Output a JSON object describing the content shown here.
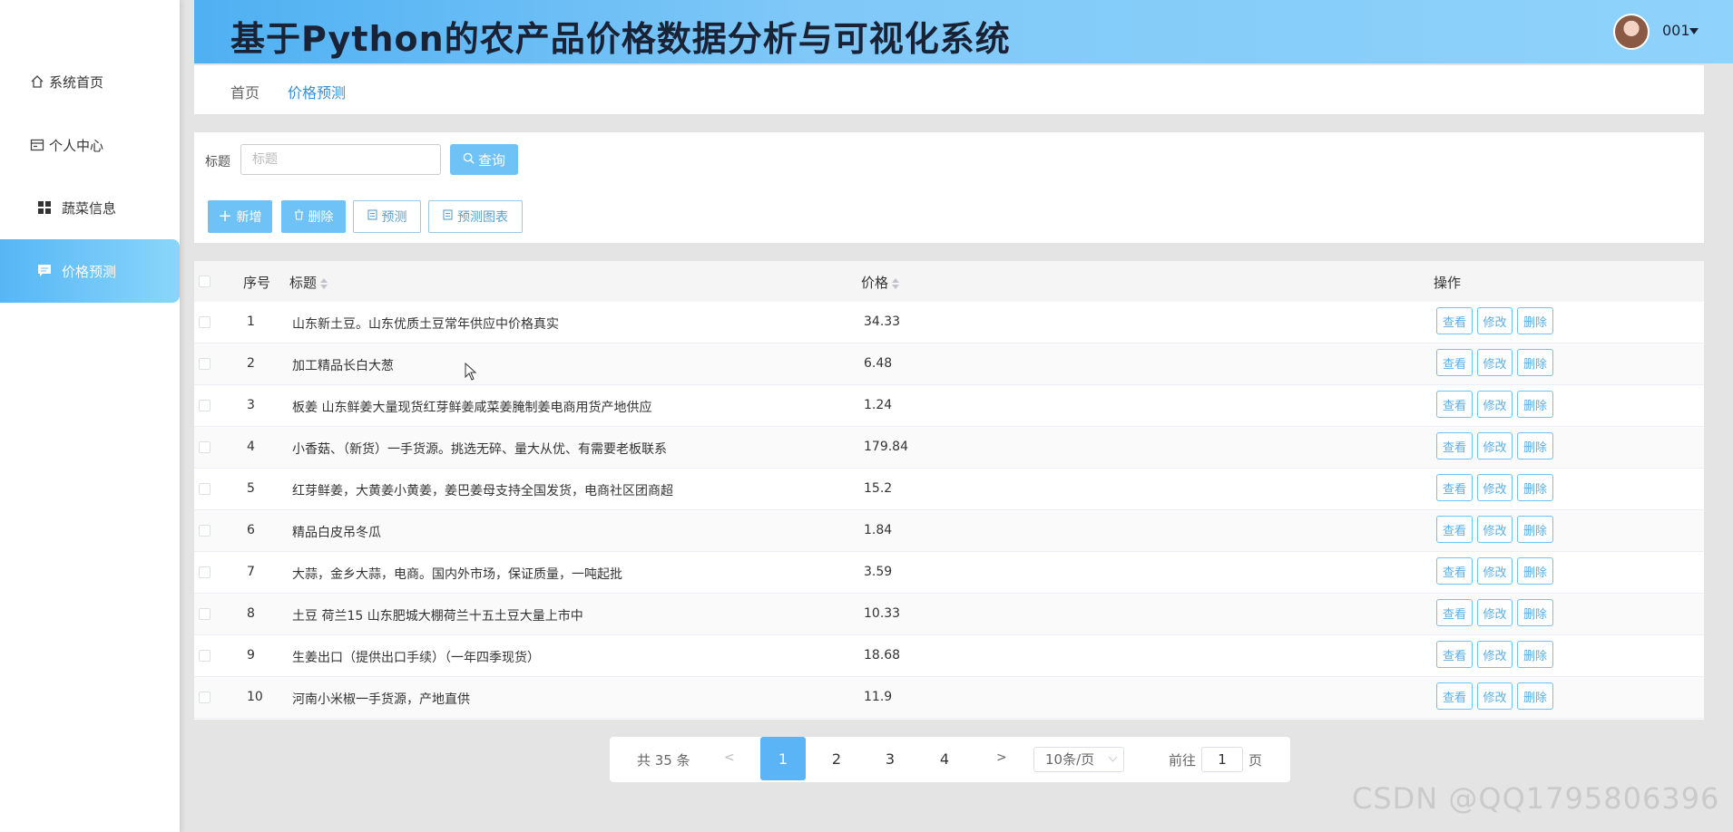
{
  "app": {
    "title": "基于Python的农产品价格数据分析与可视化系统",
    "user": "001"
  },
  "sidebar": {
    "items": [
      {
        "label": "系统首页",
        "icon": "home-icon",
        "active": false
      },
      {
        "label": "个人中心",
        "icon": "card-icon",
        "active": false
      },
      {
        "label": "蔬菜信息",
        "icon": "grid-icon",
        "active": false
      },
      {
        "label": "价格预测",
        "icon": "chat-icon",
        "active": true
      }
    ]
  },
  "breadcrumb": {
    "home": "首页",
    "current": "价格预测"
  },
  "search": {
    "label": "标题",
    "placeholder": "标题",
    "query_button": "查询"
  },
  "actions": {
    "add": "新增",
    "delete": "删除",
    "predict": "预测",
    "predict_chart": "预测图表"
  },
  "table": {
    "headers": {
      "index": "序号",
      "title": "标题",
      "price": "价格",
      "ops": "操作"
    },
    "op_labels": {
      "view": "查看",
      "edit": "修改",
      "delete": "删除"
    },
    "rows": [
      {
        "index": "1",
        "title": "山东新土豆。山东优质土豆常年供应中价格真实",
        "price": "34.33"
      },
      {
        "index": "2",
        "title": "加工精品长白大葱",
        "price": "6.48"
      },
      {
        "index": "3",
        "title": "板姜 山东鲜姜大量现货红芽鲜姜咸菜姜腌制姜电商用货产地供应",
        "price": "1.24"
      },
      {
        "index": "4",
        "title": "小香菇、（新货）一手货源。挑选无碎、量大从优、有需要老板联系",
        "price": "179.84"
      },
      {
        "index": "5",
        "title": "红芽鲜姜，大黄姜小黄姜，姜巴姜母支持全国发货，电商社区团商超",
        "price": "15.2"
      },
      {
        "index": "6",
        "title": "精品白皮吊冬瓜",
        "price": "1.84"
      },
      {
        "index": "7",
        "title": "大蒜，金乡大蒜，电商。国内外市场，保证质量，一吨起批",
        "price": "3.59"
      },
      {
        "index": "8",
        "title": "土豆 荷兰15 山东肥城大棚荷兰十五土豆大量上市中",
        "price": "10.33"
      },
      {
        "index": "9",
        "title": "生姜出口（提供出口手续）（一年四季现货）",
        "price": "18.68"
      },
      {
        "index": "10",
        "title": "河南小米椒一手货源，产地直供",
        "price": "11.9"
      }
    ]
  },
  "pagination": {
    "total": "共 35 条",
    "prev": "<",
    "pages": [
      "1",
      "2",
      "3",
      "4"
    ],
    "current": "1",
    "next": ">",
    "page_size": "10条/页",
    "goto_label": "前往",
    "goto_value": "1",
    "page_suffix": "页"
  },
  "watermark": "CSDN @QQ1795806396",
  "colors": {
    "accent": "#5ab4f5",
    "header_gradient_start": "#4fb0f2",
    "header_gradient_end": "#8fd3fb"
  }
}
